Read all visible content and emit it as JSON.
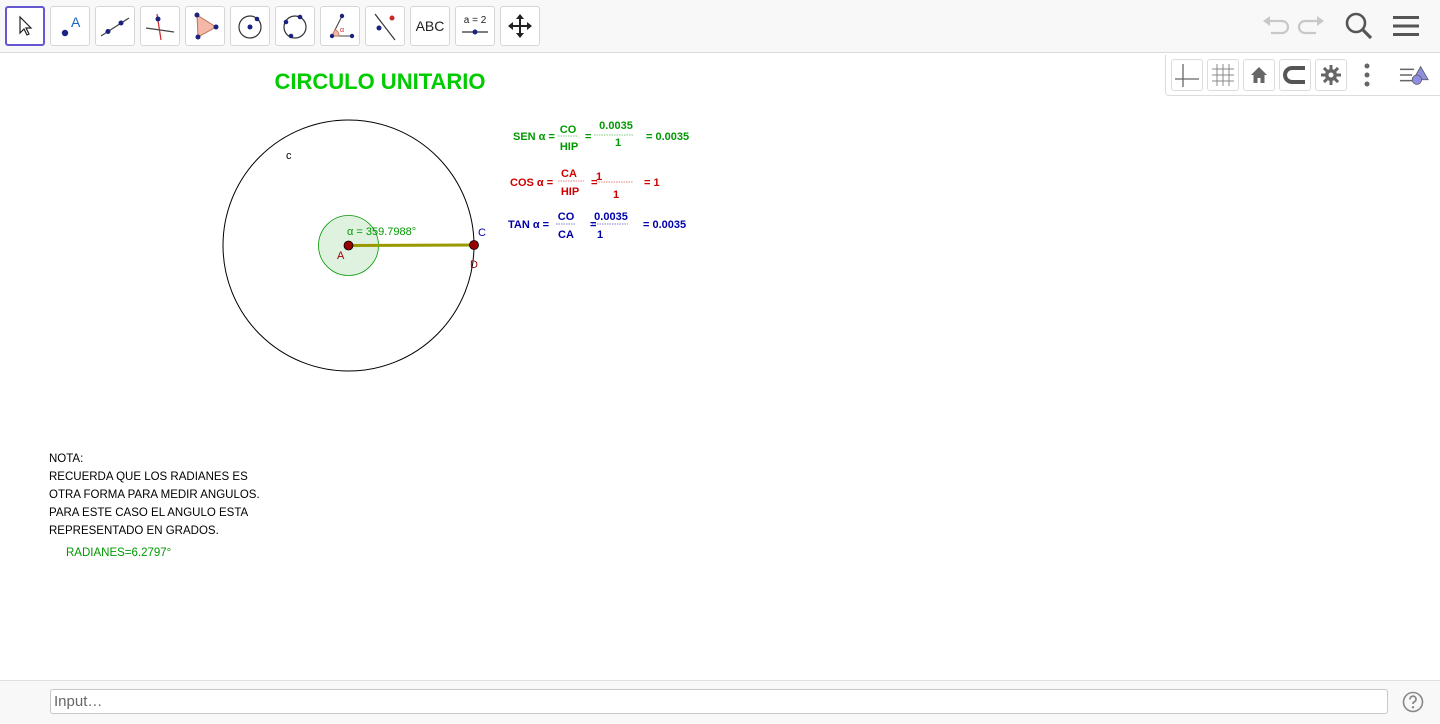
{
  "toolbar": {
    "tools": [
      {
        "name": "move-tool",
        "label": "Move"
      },
      {
        "name": "point-tool",
        "label": "Point",
        "glyph": "A"
      },
      {
        "name": "line-tool",
        "label": "Line"
      },
      {
        "name": "perpendicular-line-tool",
        "label": "Perpendicular Line"
      },
      {
        "name": "polygon-tool",
        "label": "Polygon"
      },
      {
        "name": "circle-center-point-tool",
        "label": "Circle with Center through Point"
      },
      {
        "name": "circle-three-points-tool",
        "label": "Circle through 3 Points"
      },
      {
        "name": "angle-tool",
        "label": "Angle"
      },
      {
        "name": "reflect-tool",
        "label": "Reflect about Line"
      },
      {
        "name": "text-tool",
        "label": "ABC"
      },
      {
        "name": "slider-tool",
        "label": "a = 2"
      },
      {
        "name": "move-graphics-view-tool",
        "label": "Move Graphics View"
      }
    ],
    "icons": [
      "undo-icon",
      "redo-icon",
      "search-icon",
      "menu-icon"
    ]
  },
  "stylebar": {
    "icons": [
      "axes-icon",
      "grid-icon",
      "home-icon",
      "magnet-icon",
      "settings-icon",
      "more-icon",
      "style-panel-icon"
    ]
  },
  "canvas": {
    "title": "CIRCULO UNITARIO",
    "circle_label": "c",
    "point_a": "A",
    "point_c": "C",
    "point_d": "D",
    "angle_label": "α = 359.7988°",
    "sen": {
      "label": "SEN α =",
      "num": "CO",
      "den": "HIP",
      "eq": "=",
      "val_num": "0.0035",
      "val_den": "1",
      "result": "= 0.0035"
    },
    "cos": {
      "label": "COS α =",
      "num": "CA",
      "den": "HIP",
      "eq": "=",
      "val_num": "1",
      "val_den": "1",
      "result": "= 1"
    },
    "tan": {
      "label": "TAN α =",
      "num": "CO",
      "den": "CA",
      "eq": "=",
      "val_num": "0.0035",
      "val_den": "1",
      "result": "= 0.0035"
    },
    "colors": {
      "title": "#00cc00",
      "sen": "#009900",
      "cos": "#cc0000",
      "tan": "#0000aa",
      "segment": "#999900",
      "point": "#990000"
    }
  },
  "note": {
    "lines": [
      "NOTA:",
      "RECUERDA QUE LOS RADIANES ES",
      "OTRA FORMA PARA MEDIR ANGULOS.",
      "PARA ESTE CASO EL ANGULO ESTA",
      "REPRESENTADO EN GRADOS."
    ],
    "radianes": "RADIANES=6.2797°"
  },
  "input": {
    "placeholder": "Input…"
  }
}
